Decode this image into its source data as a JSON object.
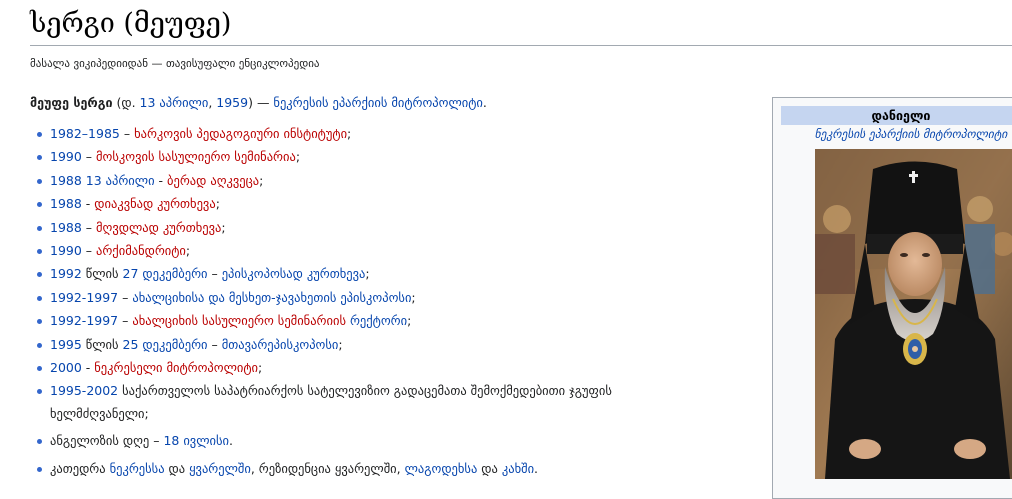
{
  "page": {
    "title": "სერგი (მეუფე)",
    "tagline": "მასალა ვიკიპედიიდან — თავისუფალი ენციკლოპედია"
  },
  "intro": {
    "subject_bold": "მეუფე სერგი",
    "open_paren": " (",
    "birth_prefix": "დ. ",
    "birth_day_link": "13 აპრილი",
    "comma": ", ",
    "birth_year_link": "1959",
    "close_dash": ") — ",
    "role_link": "ნეკრესის ეპარქიის მიტროპოლიტი",
    "period": "."
  },
  "bio": {
    "items": [
      {
        "date": "1982–1985",
        "sep": " – ",
        "text": "ხარკოვის პედაგოგიური ინსტიტუტი",
        "end": ";"
      },
      {
        "date": "1990",
        "sep": " – ",
        "text": "მოსკოვის სასულიერო სემინარია",
        "end": ";"
      },
      {
        "date": "1988 13 აპრილი",
        "sep": " - ",
        "text": "ბერად აღკვეცა",
        "end": ";"
      },
      {
        "date": "1988",
        "sep": " - ",
        "text": "დიაკვნად კურთხევა",
        "end": ";"
      },
      {
        "date": "1988",
        "sep": " – ",
        "text": "მღვდლად კურთხევა",
        "end": ";"
      },
      {
        "date": "1990",
        "sep": " – ",
        "text": "არქიმანდრიტი",
        "end": ";"
      },
      {
        "date": "1992",
        "mid": " წლის ",
        "date2": "27 დეკემბერი",
        "sep": " – ",
        "text": "ეპისკოპოსად კურთხევა",
        "end": ";"
      },
      {
        "date": "1992-1997",
        "sep": " – ",
        "text": "ახალციხისა და მესხეთ-ჯავახეთის ეპისკოპოსი",
        "end": ";"
      },
      {
        "date": "1992-1997",
        "sep": " – ",
        "text_a": "ახალციხის სასულიერო სემინარიის",
        "text_b": "რექტორი",
        "end": ";"
      },
      {
        "date": "1995",
        "mid": " წლის ",
        "date2": "25 დეკემბერი",
        "sep": " – ",
        "text": "მთავარეპისკოპოსი",
        "end": ";"
      },
      {
        "date": "2000",
        "sep": " - ",
        "text": "ნეკრესელი მიტროპოლიტი",
        "end": ";"
      },
      {
        "date": "1995-2002",
        "sep": " ",
        "text": "საქართველოს საპატრიარქოს სატელევიზიო გადაცემათა შემოქმედებითი ჯგუფის ხელმძღვანელი",
        "end": ";"
      },
      {
        "lead": "ანგელოზის დღე – ",
        "date": "18 ივლისი",
        "end": "."
      },
      {
        "lead": "კათედრა ",
        "link1": "ნეკრესსა",
        "mid": " და ",
        "link2": "ყვარელში",
        "mid2": ", რეზიდენცია ყვარელში, ",
        "link3": "ლაგოდეხსა",
        "mid3": " და ",
        "link4": "კახში",
        "end": "."
      }
    ]
  },
  "infobox": {
    "header": "დანიელი",
    "caption": "ნეკრესის ეპარქიის მიტროპოლიტი"
  },
  "colors": {
    "link": "#0645ad",
    "redlink": "#ba0000",
    "header_bg": "#c5d5f0"
  }
}
